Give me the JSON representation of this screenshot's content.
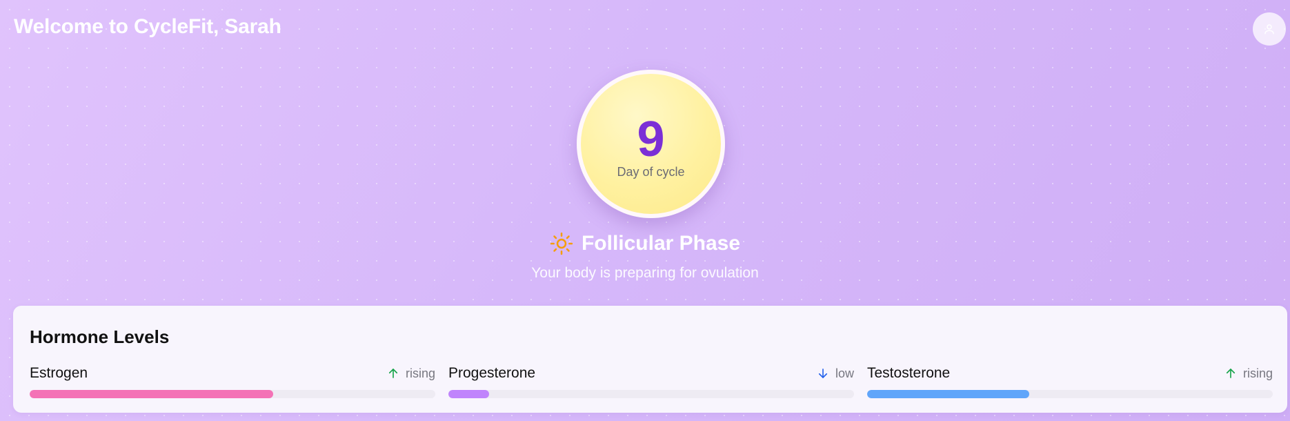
{
  "header": {
    "title": "Welcome to CycleFit, Sarah",
    "avatar_icon": "user-icon"
  },
  "cycle": {
    "day": "9",
    "day_label": "Day of cycle"
  },
  "phase": {
    "icon": "sun-icon",
    "name": "Follicular Phase",
    "description": "Your body is preparing for ovulation"
  },
  "hormones": {
    "title": "Hormone Levels",
    "items": [
      {
        "name": "Estrogen",
        "trend": "rising",
        "trend_icon": "arrow-up-icon",
        "level": 0.6,
        "color": "#f472b6",
        "trend_color": "#16a34a"
      },
      {
        "name": "Progesterone",
        "trend": "low",
        "trend_icon": "arrow-down-icon",
        "level": 0.1,
        "color": "#c084fc",
        "trend_color": "#2563eb"
      },
      {
        "name": "Testosterone",
        "trend": "rising",
        "trend_icon": "arrow-up-icon",
        "level": 0.4,
        "color": "#60a5fa",
        "trend_color": "#16a34a"
      }
    ]
  }
}
